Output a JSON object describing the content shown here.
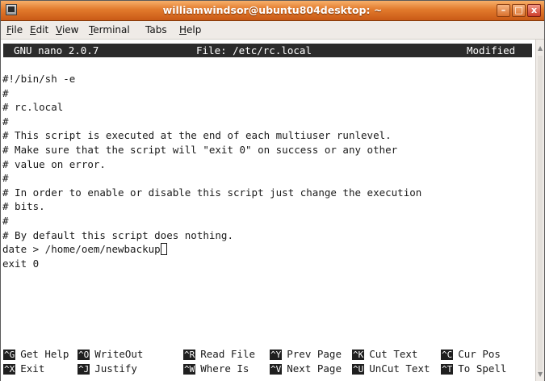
{
  "window": {
    "title": "williamwindsor@ubuntu804desktop: ~",
    "minimize_glyph": "–",
    "maximize_glyph": "□",
    "close_glyph": "x"
  },
  "menu": {
    "items": [
      {
        "mnemonic": "F",
        "rest": "ile"
      },
      {
        "mnemonic": "E",
        "rest": "dit"
      },
      {
        "mnemonic": "V",
        "rest": "iew"
      },
      {
        "mnemonic": "T",
        "rest": "erminal"
      },
      {
        "mnemonic": "Ta",
        "rest": "bs"
      },
      {
        "mnemonic": "H",
        "rest": "elp"
      }
    ]
  },
  "nano": {
    "version": "GNU nano 2.0.7",
    "file": "File: /etc/rc.local",
    "state": "Modified",
    "lines": [
      "#!/bin/sh -e",
      "#",
      "# rc.local",
      "#",
      "# This script is executed at the end of each multiuser runlevel.",
      "# Make sure that the script will \"exit 0\" on success or any other",
      "# value on error.",
      "#",
      "# In order to enable or disable this script just change the execution",
      "# bits.",
      "#",
      "# By default this script does nothing.",
      "date > /home/oem/newbackup",
      "exit 0"
    ],
    "shortcuts_row1": [
      {
        "key": "^G",
        "label": "Get Help"
      },
      {
        "key": "^O",
        "label": "WriteOut"
      },
      {
        "key": "^R",
        "label": "Read File"
      },
      {
        "key": "^Y",
        "label": "Prev Page"
      },
      {
        "key": "^K",
        "label": "Cut Text"
      },
      {
        "key": "^C",
        "label": "Cur Pos"
      }
    ],
    "shortcuts_row2": [
      {
        "key": "^X",
        "label": "Exit"
      },
      {
        "key": "^J",
        "label": "Justify"
      },
      {
        "key": "^W",
        "label": "Where Is"
      },
      {
        "key": "^V",
        "label": "Next Page"
      },
      {
        "key": "^U",
        "label": "UnCut Text"
      },
      {
        "key": "^T",
        "label": "To Spell"
      }
    ]
  },
  "colors": {
    "titlebar": "#e27a2c",
    "statusbar": "#2b2b2b",
    "menubar": "#efebe7"
  }
}
